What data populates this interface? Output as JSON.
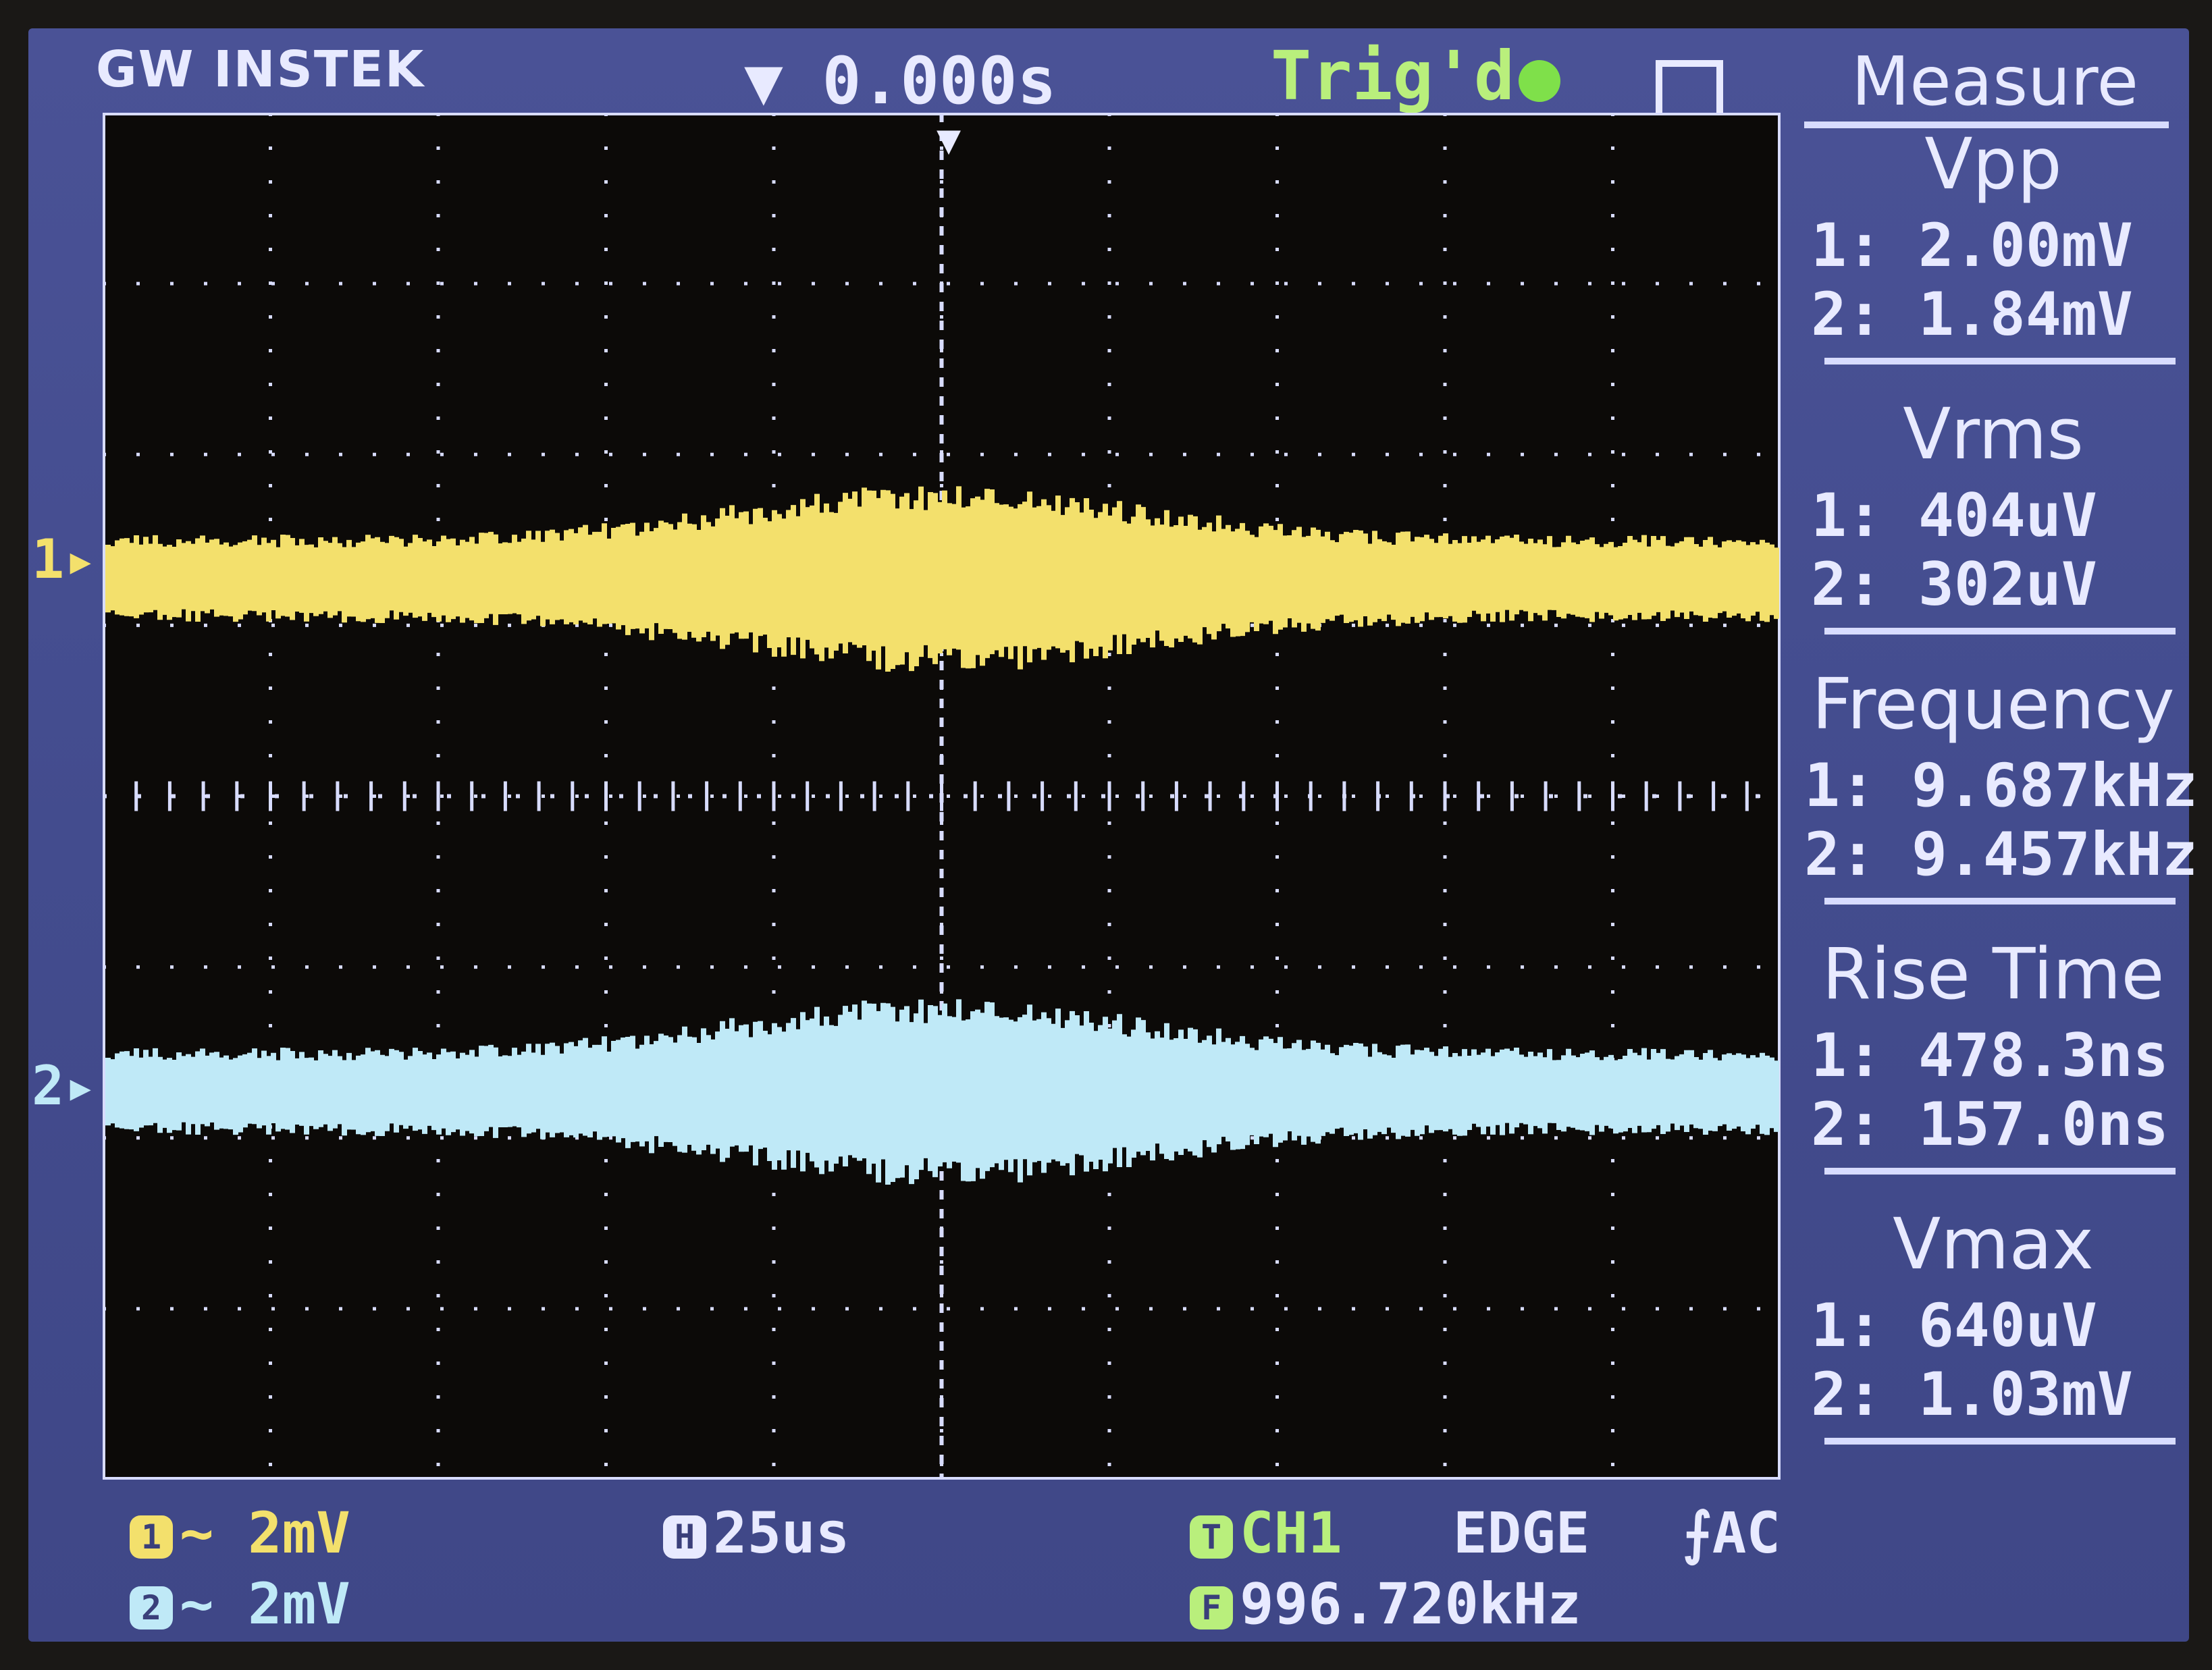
{
  "header": {
    "brand": "GW INSTEK",
    "time_position": "▼ 0.000s",
    "trigger_status": "Trig'd"
  },
  "panel": {
    "title": "Measure",
    "measurements": [
      {
        "name": "Vpp",
        "ch1": "1: 2.00mV",
        "ch2": "2: 1.84mV"
      },
      {
        "name": "Vrms",
        "ch1": "1: 404uV",
        "ch2": "2: 302uV"
      },
      {
        "name": "Frequency",
        "ch1": "1: 9.687kHz",
        "ch2": "2: 9.457kHz"
      },
      {
        "name": "Rise Time",
        "ch1": "1: 478.3ns",
        "ch2": "2: 157.0ns"
      },
      {
        "name": "Vmax",
        "ch1": "1: 640uV",
        "ch2": "2: 1.03mV"
      }
    ]
  },
  "channels": {
    "ch1_marker": "1",
    "ch2_marker": "2"
  },
  "status_bar": {
    "ch1_scale": "~ 2mV",
    "ch2_scale": "~ 2mV",
    "timebase": "25us",
    "trigger_source": "CH1",
    "trigger_type": "EDGE",
    "trigger_coupling": "AC",
    "trigger_frequency": "996.720kHz"
  },
  "colors": {
    "ch1": "#f3e06c",
    "ch2": "#bfe9f7",
    "trigger": "#b9ef7c",
    "background": "#444c8c"
  }
}
